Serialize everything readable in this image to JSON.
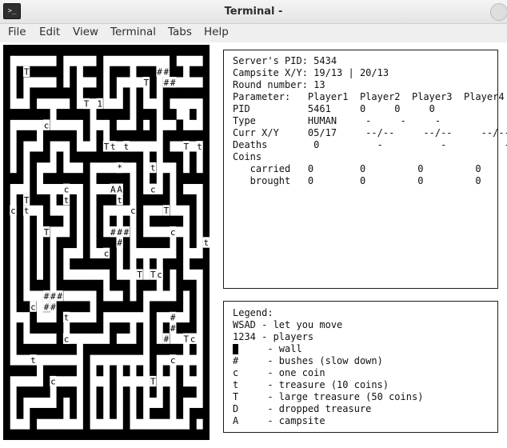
{
  "window": {
    "title": "Terminal -",
    "icon": "terminal-icon",
    "icon_glyph": ">_"
  },
  "menu": [
    "File",
    "Edit",
    "View",
    "Terminal",
    "Tabs",
    "Help"
  ],
  "maze": {
    "legend": {
      "#": "wall",
      ".": "empty"
    },
    "rows": [
      "###############################",
      "#.......#.....#..........#....#",
      "#.#######.#.###.###.###..##.###",
      "#.#.....#.#...#.#.....#.#.....#",
      "#.#.#######.###.#.#.#.#.#######",
      "#...#.....#...#...#.#...#.....#",
      "#######.#####.#####.###.##..#.#",
      "#.....#.....#...#...#.#...#...#",
      "#.###.#####.#.#.#######.#######",
      "#.#...#...#...#.........#.....#",
      "#.#.###.#.###########.#.###.#.#",
      "#.#.#...#...#.......#.#...#.#.#",
      "###.#.#######.#####.#.#.#.#####",
      "#...#.......#.....#.#...#.#...#",
      "#.#####.###.#.#####.#####.###.#",
      "#.#...#...#.#.#.....#...#...#.#",
      "#.#.#.###.#.#.#.#.#.#.#####.#.#",
      "#.#.#.#...#.#.#...#.#.......#.#",
      "#.#.#.#.###.#.###.#.#####.#.#.#",
      "#.#.#.#.#...#...#.#.......#...#",
      "#.#.#.#.#.#######.#.#.#.###.###",
      "#.#.#.#.#.......#...#.#.#.#...#",
      "#.#.###.#######.###.###.#.###.#",
      "#.#...#.#.....#...#.#.....#.#.#",
      "#.###.#.#####.#######.#####.#.#",
      "#...#...#.....#.......#.....#.#",
      "#.#.#####.#####.###.#.#.#.###.#",
      "#.#.....#.......#...#.#.#.....#",
      "#.#########.#########.#####.#.#",
      "#...........#.........#.......#",
      "#####.#####.#.#.#.#.#.#.#.#.#.#",
      "#.....#.....#...#.....#...#...#",
      "#.#####.###.#.#.#.#.#.#.#.###.#",
      "#.#.....#.#.#.#.#.#.#...#.#...#",
      "#.#.#####.#.#.#.#.#.#.###.#.###",
      "#...#.......#.....#.........#.#",
      "###############################"
    ],
    "items": [
      {
        "ch": "T",
        "r": 2,
        "c": 3
      },
      {
        "ch": "#",
        "r": 2,
        "c": 23
      },
      {
        "ch": "#",
        "r": 2,
        "c": 24
      },
      {
        "ch": "T",
        "r": 3,
        "c": 21
      },
      {
        "ch": "#",
        "r": 3,
        "c": 24
      },
      {
        "ch": "#",
        "r": 3,
        "c": 25
      },
      {
        "ch": "T",
        "r": 5,
        "c": 12
      },
      {
        "ch": "1",
        "r": 5,
        "c": 14
      },
      {
        "ch": "c",
        "r": 7,
        "c": 6
      },
      {
        "ch": "T",
        "r": 9,
        "c": 15
      },
      {
        "ch": "t",
        "r": 9,
        "c": 16
      },
      {
        "ch": "t",
        "r": 9,
        "c": 18
      },
      {
        "ch": "T",
        "r": 9,
        "c": 27
      },
      {
        "ch": "t",
        "r": 9,
        "c": 29
      },
      {
        "ch": "*",
        "r": 11,
        "c": 17
      },
      {
        "ch": "t",
        "r": 11,
        "c": 22
      },
      {
        "ch": "c",
        "r": 13,
        "c": 9
      },
      {
        "ch": "A",
        "r": 13,
        "c": 16
      },
      {
        "ch": "A",
        "r": 13,
        "c": 17
      },
      {
        "ch": "c",
        "r": 13,
        "c": 22
      },
      {
        "ch": "T",
        "r": 14,
        "c": 3
      },
      {
        "ch": "t",
        "r": 14,
        "c": 9
      },
      {
        "ch": "t",
        "r": 14,
        "c": 17
      },
      {
        "ch": "c",
        "r": 15,
        "c": 1
      },
      {
        "ch": "t",
        "r": 15,
        "c": 3
      },
      {
        "ch": "c",
        "r": 15,
        "c": 19
      },
      {
        "ch": "T",
        "r": 15,
        "c": 24
      },
      {
        "ch": "T",
        "r": 17,
        "c": 6
      },
      {
        "ch": "#",
        "r": 17,
        "c": 16
      },
      {
        "ch": "#",
        "r": 17,
        "c": 17
      },
      {
        "ch": "#",
        "r": 17,
        "c": 18
      },
      {
        "ch": "c",
        "r": 17,
        "c": 25
      },
      {
        "ch": "#",
        "r": 18,
        "c": 17
      },
      {
        "ch": "t",
        "r": 18,
        "c": 30
      },
      {
        "ch": "c",
        "r": 19,
        "c": 15
      },
      {
        "ch": "T",
        "r": 21,
        "c": 20
      },
      {
        "ch": "T",
        "r": 21,
        "c": 22
      },
      {
        "ch": "c",
        "r": 21,
        "c": 23
      },
      {
        "ch": "#",
        "r": 23,
        "c": 6
      },
      {
        "ch": "#",
        "r": 23,
        "c": 7
      },
      {
        "ch": "#",
        "r": 23,
        "c": 8
      },
      {
        "ch": "c",
        "r": 24,
        "c": 4
      },
      {
        "ch": "#",
        "r": 24,
        "c": 6
      },
      {
        "ch": "#",
        "r": 24,
        "c": 7
      },
      {
        "ch": "t",
        "r": 25,
        "c": 9
      },
      {
        "ch": "#",
        "r": 25,
        "c": 25
      },
      {
        "ch": "#",
        "r": 26,
        "c": 25
      },
      {
        "ch": "c",
        "r": 27,
        "c": 9
      },
      {
        "ch": "#",
        "r": 27,
        "c": 24
      },
      {
        "ch": "T",
        "r": 27,
        "c": 27
      },
      {
        "ch": "c",
        "r": 27,
        "c": 28
      },
      {
        "ch": "t",
        "r": 29,
        "c": 4
      },
      {
        "ch": "c",
        "r": 29,
        "c": 25
      },
      {
        "ch": "c",
        "r": 31,
        "c": 7
      },
      {
        "ch": "T",
        "r": 31,
        "c": 22
      }
    ]
  },
  "stats": {
    "lines": [
      "Server's PID: 5434",
      "Campsite X/Y: 19/13 | 20/13",
      "Round number: 13",
      "Parameter:   Player1  Player2  Player3  Player4",
      "PID          5461     0     0     0",
      "Type         HUMAN     -     -     -",
      "Curr X/Y     05/17     --/--     --/--     --/--",
      "Deaths        0          -          -          -",
      "Coins",
      "   carried   0        0         0         0",
      "   brought   0        0         0         0"
    ]
  },
  "legend": {
    "lines": [
      "Legend:",
      "WSAD - let you move",
      "1234 - players",
      "      - wall",
      "#     - bushes (slow down)",
      "c     - one coin",
      "t     - treasure (10 coins)",
      "T     - large treasure (50 coins)",
      "D     - dropped treasure",
      "A     - campsite"
    ]
  }
}
